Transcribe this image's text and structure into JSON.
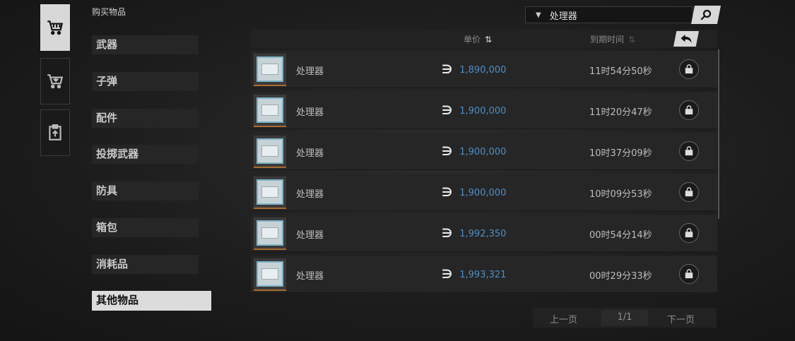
{
  "section_title": "购买物品",
  "side_tabs": [
    {
      "name": "buy-cart",
      "icon": "cart-icon",
      "active": true
    },
    {
      "name": "sell-cart",
      "icon": "cart-arrow-icon",
      "active": false
    },
    {
      "name": "listings",
      "icon": "clipboard-upload-icon",
      "active": false
    }
  ],
  "categories": [
    "武器",
    "子弹",
    "配件",
    "投掷武器",
    "防具",
    "箱包",
    "消耗品",
    "其他物品"
  ],
  "active_category": "其他物品",
  "search": {
    "value": "处理器",
    "icon": "search-icon"
  },
  "table": {
    "col_price": "单价",
    "col_expire": "到期时间",
    "currency_symbol": "∋",
    "rows": [
      {
        "name": "处理器",
        "price": "1,890,000",
        "expire": "11时54分50秒"
      },
      {
        "name": "处理器",
        "price": "1,900,000",
        "expire": "11时20分47秒"
      },
      {
        "name": "处理器",
        "price": "1,900,000",
        "expire": "10时37分09秒"
      },
      {
        "name": "处理器",
        "price": "1,900,000",
        "expire": "10时09分53秒"
      },
      {
        "name": "处理器",
        "price": "1,992,350",
        "expire": "00时54分14秒"
      },
      {
        "name": "处理器",
        "price": "1,993,321",
        "expire": "00时29分33秒"
      }
    ]
  },
  "pager": {
    "prev": "上一页",
    "page": "1/1",
    "next": "下一页"
  },
  "colors": {
    "price": "#4d8fc8",
    "accent_light": "#dcdcdc",
    "thumb_border": "#a86a30"
  }
}
